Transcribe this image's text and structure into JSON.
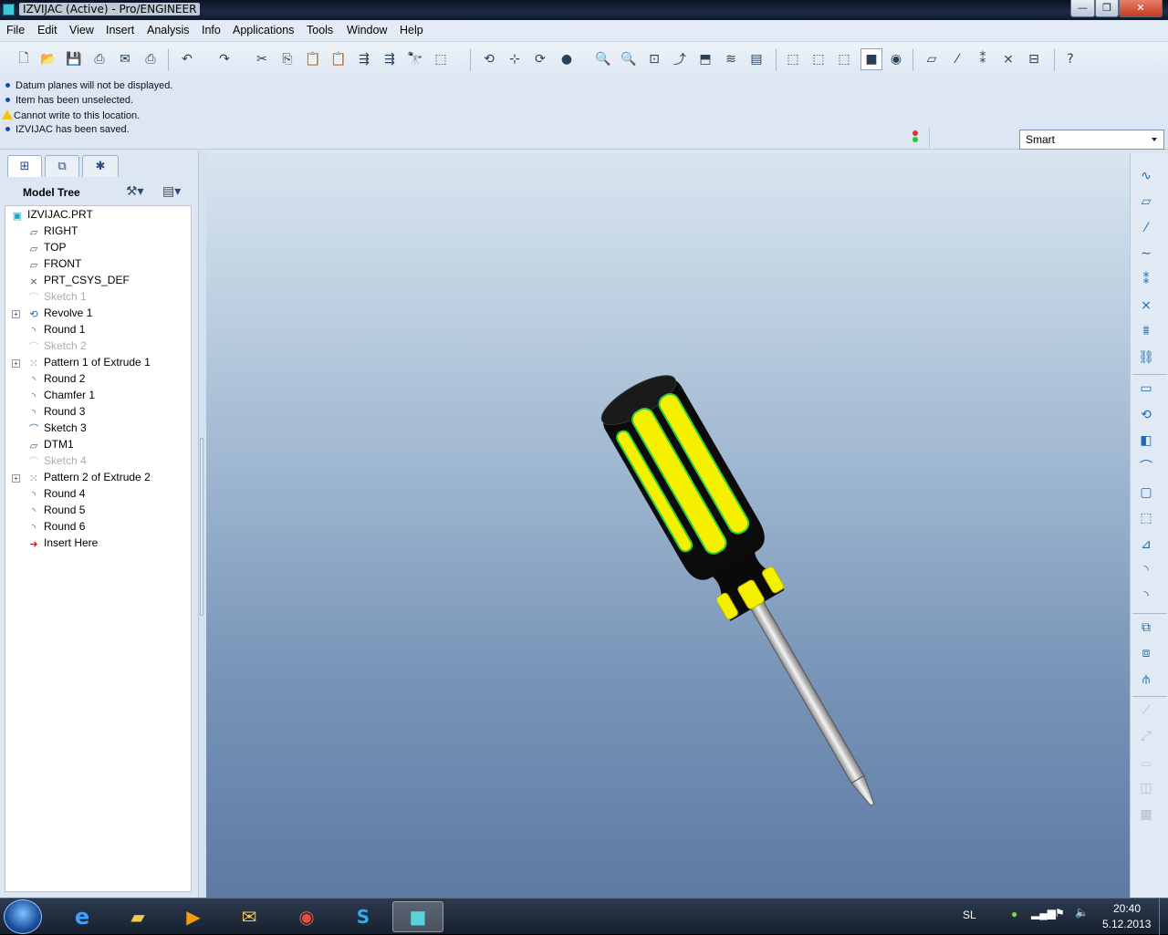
{
  "window": {
    "title": "IZVIJAC (Active) - Pro/ENGINEER",
    "controls": {
      "minimize": "—",
      "maximize": "❐",
      "close": "✕"
    }
  },
  "menu": {
    "items": [
      "File",
      "Edit",
      "View",
      "Insert",
      "Analysis",
      "Info",
      "Applications",
      "Tools",
      "Window",
      "Help"
    ]
  },
  "toolbar": {
    "icons": [
      "new-icon",
      "open-icon",
      "save-icon",
      "print-icon",
      "send-icon",
      "print-preview-icon",
      "undo-icon",
      "redo-icon",
      "cut-icon",
      "copy-icon",
      "paste-icon",
      "paste-special-icon",
      "regenerate-icon",
      "regen-manager-icon",
      "find-icon",
      "select-box-icon",
      "redraw-icon",
      "spin-center-icon",
      "orient-icon",
      "appearance-icon",
      "zoom-in-icon",
      "zoom-out-icon",
      "refit-icon",
      "reorient-icon",
      "saved-views-icon",
      "layers-icon",
      "view-manager-icon",
      "wireframe-icon",
      "hidden-line-icon",
      "no-hidden-icon",
      "shading-icon",
      "enhanced-realism-icon",
      "datum-planes-icon",
      "datum-axes-icon",
      "datum-points-icon",
      "csys-icon",
      "annotations-icon",
      "context-help-icon"
    ]
  },
  "messages": [
    {
      "type": "info",
      "text": "Datum planes will not be displayed."
    },
    {
      "type": "info",
      "text": "Item has been unselected."
    },
    {
      "type": "warning",
      "text": "Cannot write to this location."
    },
    {
      "type": "info",
      "text": "IZVIJAC has been saved."
    }
  ],
  "filter": {
    "selected": "Smart"
  },
  "model_tree": {
    "header": "Model Tree",
    "nodes": [
      {
        "label": "IZVIJAC.PRT",
        "icon": "part-icon",
        "level": 0
      },
      {
        "label": "RIGHT",
        "icon": "datum-plane-icon",
        "level": 1
      },
      {
        "label": "TOP",
        "icon": "datum-plane-icon",
        "level": 1
      },
      {
        "label": "FRONT",
        "icon": "datum-plane-icon",
        "level": 1
      },
      {
        "label": "PRT_CSYS_DEF",
        "icon": "csys-icon",
        "level": 1
      },
      {
        "label": "Sketch 1",
        "icon": "sketch-icon",
        "level": 1,
        "dim": true
      },
      {
        "label": "Revolve 1",
        "icon": "revolve-icon",
        "level": 1,
        "expandable": true
      },
      {
        "label": "Round 1",
        "icon": "round-icon",
        "level": 1
      },
      {
        "label": "Sketch 2",
        "icon": "sketch-icon",
        "level": 1,
        "dim": true
      },
      {
        "label": "Pattern 1 of Extrude 1",
        "icon": "pattern-icon",
        "level": 1,
        "expandable": true
      },
      {
        "label": "Round 2",
        "icon": "round-icon",
        "level": 1
      },
      {
        "label": "Chamfer 1",
        "icon": "chamfer-icon",
        "level": 1
      },
      {
        "label": "Round 3",
        "icon": "round-icon",
        "level": 1
      },
      {
        "label": "Sketch 3",
        "icon": "sketch-active-icon",
        "level": 1
      },
      {
        "label": "DTM1",
        "icon": "datum-plane-icon",
        "level": 1
      },
      {
        "label": "Sketch 4",
        "icon": "sketch-icon",
        "level": 1,
        "dim": true
      },
      {
        "label": "Pattern 2 of Extrude 2",
        "icon": "pattern-icon",
        "level": 1,
        "expandable": true
      },
      {
        "label": "Round 4",
        "icon": "round-icon",
        "level": 1
      },
      {
        "label": "Round 5",
        "icon": "round-icon",
        "level": 1
      },
      {
        "label": "Round 6",
        "icon": "round-icon",
        "level": 1
      },
      {
        "label": "Insert Here",
        "icon": "insert-arrow-icon",
        "level": 1
      }
    ]
  },
  "right_toolbar": {
    "icons": [
      "sketch-tool-icon",
      "datum-plane-tool-icon",
      "datum-axis-tool-icon",
      "datum-curve-tool-icon",
      "datum-point-tool-icon",
      "csys-tool-icon",
      "analysis-tool-icon",
      "udf-tool-icon",
      "extrude-icon",
      "revolve-tool-icon",
      "variable-section-sweep-icon",
      "hole-icon",
      "shell-icon",
      "rib-icon",
      "draft-icon",
      "round-tool-icon",
      "chamfer-tool-icon",
      "pattern-tool-icon",
      "mirror-icon",
      "merge-icon",
      "trim-icon",
      "extend-icon",
      "offset-icon",
      "thicken-icon",
      "solidify-icon"
    ]
  },
  "taskbar": {
    "apps": [
      "internet-explorer-icon",
      "file-explorer-icon",
      "media-player-icon",
      "outlook-icon",
      "chrome-icon",
      "skype-icon",
      "proe-icon"
    ],
    "language": "SL",
    "time": "20:40",
    "date": "5.12.2013"
  },
  "colors": {
    "handle_yellow": "#f4f000",
    "handle_black": "#0a0a0a",
    "grip_green": "#2ecc40",
    "shaft": "#c9c9c9",
    "accent_blue": "#1e6ab0"
  }
}
